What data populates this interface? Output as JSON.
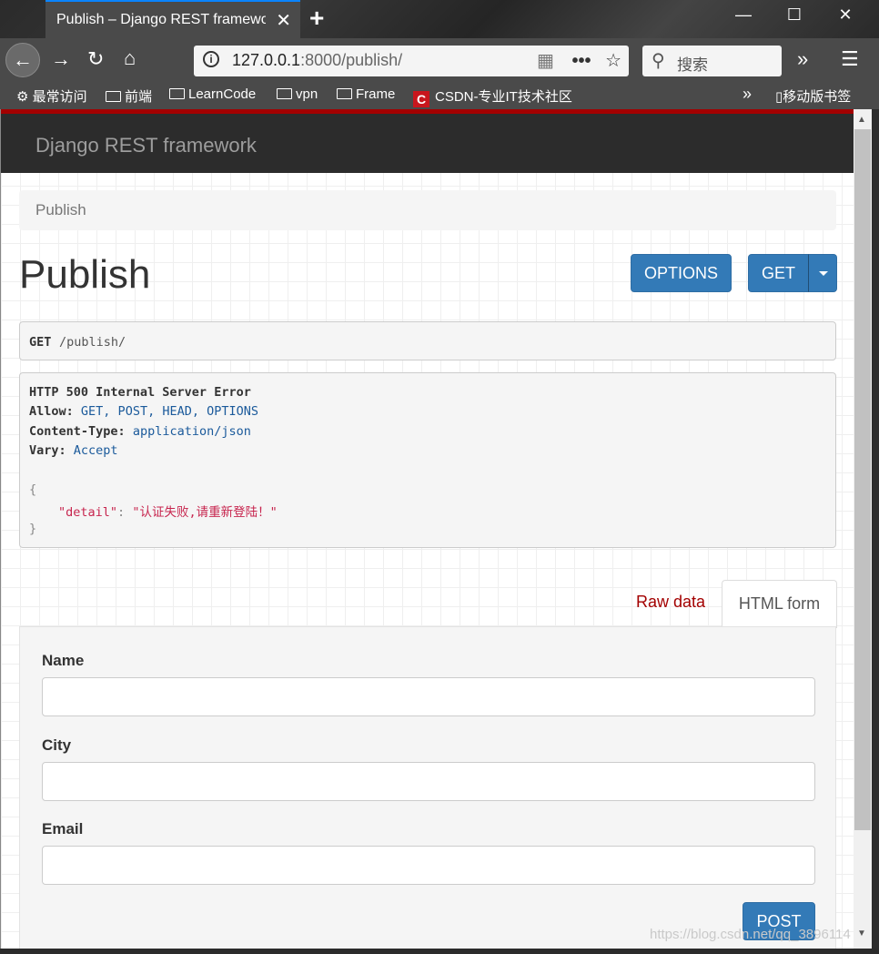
{
  "browser": {
    "tab_title": "Publish – Django REST framework",
    "newtab_label": "+",
    "url_host": "127.0.0.1",
    "url_rest": ":8000/publish/",
    "search_placeholder": "搜索",
    "bookmarks": [
      {
        "label": "最常访问",
        "icon": "gear-icon"
      },
      {
        "label": "前端",
        "icon": "folder-icon"
      },
      {
        "label": "LearnCode",
        "icon": "folder-icon"
      },
      {
        "label": "vpn",
        "icon": "folder-icon"
      },
      {
        "label": "Frame",
        "icon": "folder-icon"
      },
      {
        "label": "CSDN-专业IT技术社区",
        "icon": "csdn-icon"
      }
    ],
    "mobile_bookmarks": "移动版书签"
  },
  "drf": {
    "brand": "Django REST framework",
    "breadcrumb": "Publish",
    "page_title": "Publish",
    "options_label": "OPTIONS",
    "get_label": "GET",
    "request": {
      "method": "GET",
      "path": "/publish/"
    },
    "response": {
      "status": "HTTP 500 Internal Server Error",
      "allow_key": "Allow:",
      "allow_val": "GET, POST, HEAD, OPTIONS",
      "ctype_key": "Content-Type:",
      "ctype_val": "application/json",
      "vary_key": "Vary:",
      "vary_val": "Accept",
      "open_brace": "{",
      "json_key": "\"detail\"",
      "colon": ":",
      "json_val": "\"认证失败,请重新登陆！\"",
      "close_brace": "}"
    },
    "tabs": {
      "raw": "Raw data",
      "html": "HTML form"
    },
    "form": {
      "fields": [
        {
          "label": "Name",
          "value": ""
        },
        {
          "label": "City",
          "value": ""
        },
        {
          "label": "Email",
          "value": ""
        }
      ],
      "submit": "POST"
    }
  },
  "watermark": "https://blog.csdn.net/qq_3896114"
}
